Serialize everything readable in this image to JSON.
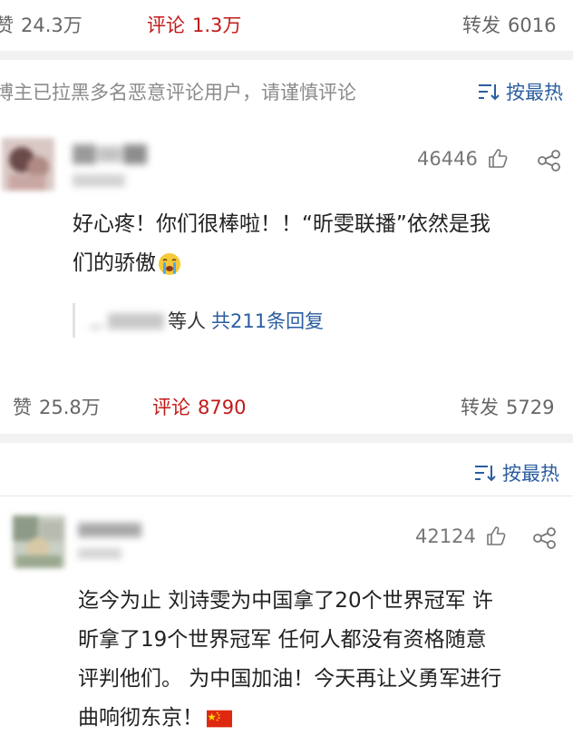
{
  "post1_stats": {
    "like_label": "赞",
    "like_count": "24.3万",
    "comment_label": "评论",
    "comment_count": "1.3万",
    "repost_label": "转发",
    "repost_count": "6016"
  },
  "notice": "博主已拉黑多名恶意评论用户，请谨慎评论",
  "sort1_label": "按最热",
  "comment1": {
    "likes": "46446",
    "text_line1": "好心疼！你们很棒啦！！“昕雯联播”依然是我",
    "text_line2": "们的骄傲",
    "reply_suffix": "等人",
    "reply_link": "共211条回复"
  },
  "post2_stats": {
    "like_label": "赞",
    "like_count": "25.8万",
    "comment_label": "评论",
    "comment_count": "8790",
    "repost_label": "转发",
    "repost_count": "5729"
  },
  "sort2_label": "按最热",
  "comment2": {
    "likes": "42124",
    "text_line1": "迄今为止 刘诗雯为中国拿了20个世界冠军 许",
    "text_line2": "昕拿了19个世界冠军 任何人都没有资格随意",
    "text_line3": "评判他们。 为中国加油！今天再让义勇军进行",
    "text_line4": "曲响彻东京！"
  },
  "icons": {
    "thumb": "thumbs-up-icon",
    "share": "share-icon",
    "sort": "sort-icon",
    "crying": "crying-face-emoji",
    "flag": "china-flag-emoji"
  },
  "colors": {
    "accent_blue": "#2a5d9f",
    "comment_red": "#c21a1a",
    "muted": "#8a8a8a"
  }
}
